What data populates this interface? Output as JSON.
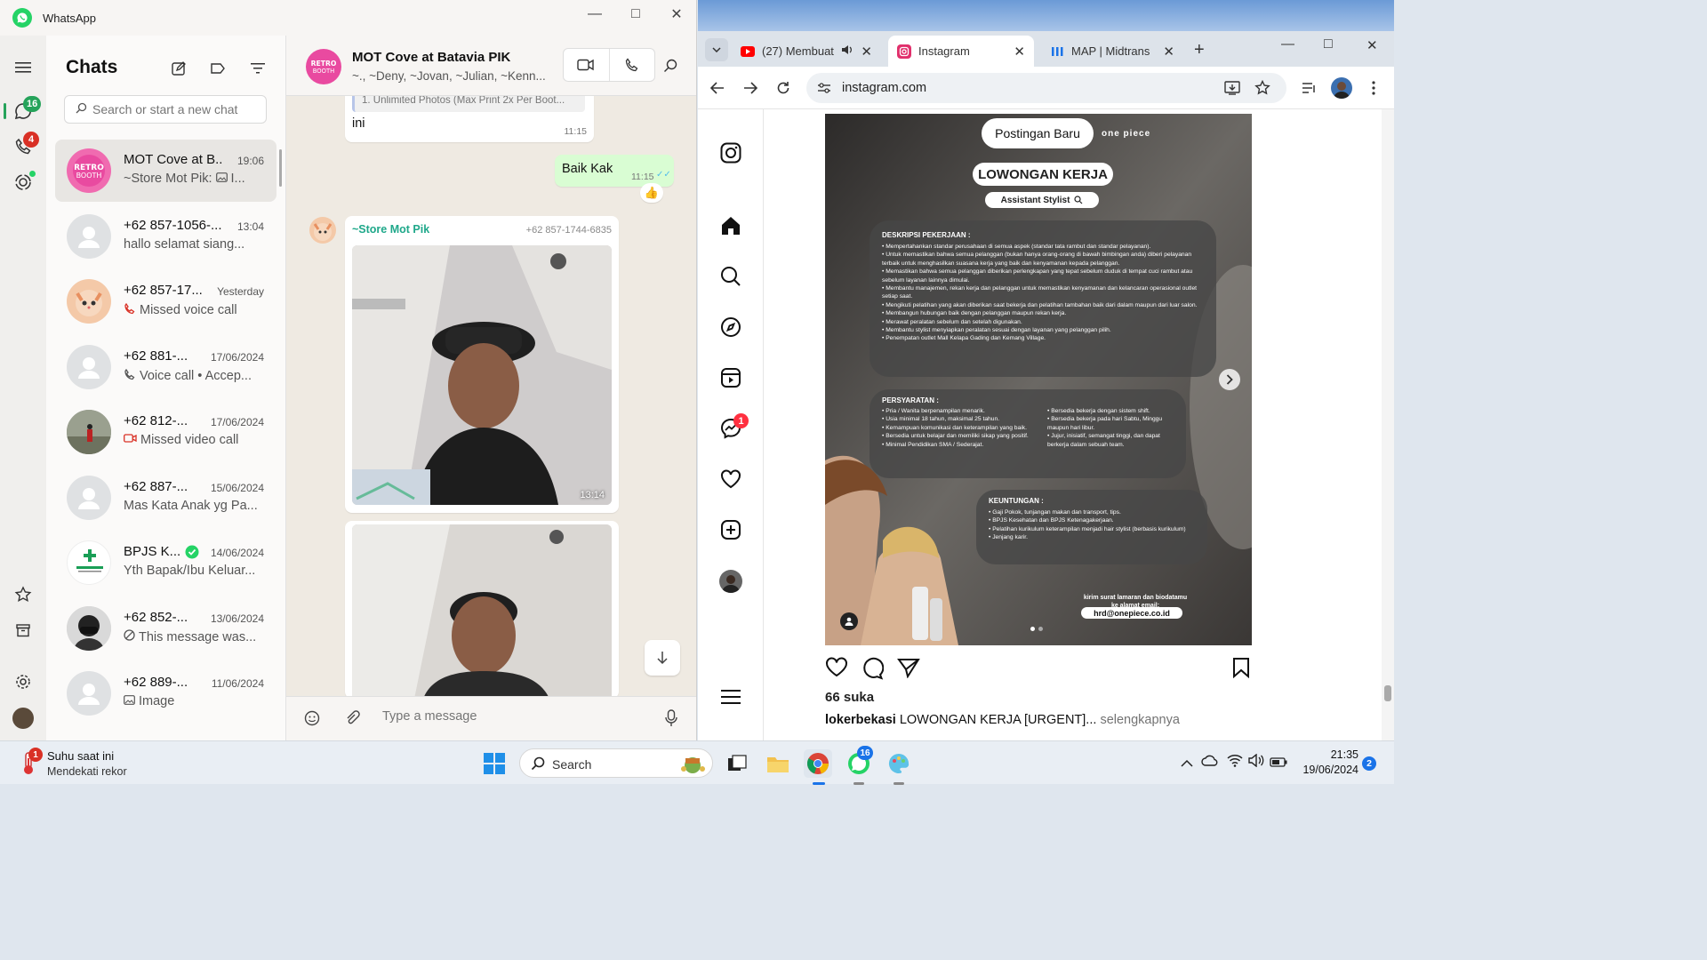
{
  "whatsapp": {
    "app_title": "WhatsApp",
    "rail": {
      "chats_badge": "16",
      "calls_badge": "4"
    },
    "list_title": "Chats",
    "search_placeholder": "Search or start a new chat",
    "chats": [
      {
        "name": "MOT Cove at B...",
        "time": "19:06",
        "preview": "~Store Mot Pik: ",
        "preview_suffix": "I...",
        "icon": "image-icon"
      },
      {
        "name": "+62 857-1056-...",
        "time": "13:04",
        "preview": "hallo selamat siang..."
      },
      {
        "name": "+62 857-17...",
        "time": "Yesterday",
        "preview": "Missed voice call",
        "icon": "missed-call-icon"
      },
      {
        "name": "+62 881-...",
        "time": "17/06/2024",
        "preview": "Voice call • Accep...",
        "icon": "incoming-call-icon"
      },
      {
        "name": "+62 812-...",
        "time": "17/06/2024",
        "preview": "Missed video call",
        "icon": "missed-video-icon"
      },
      {
        "name": "+62 887-...",
        "time": "15/06/2024",
        "preview": "Mas Kata Anak yg Pa..."
      },
      {
        "name": "BPJS K...",
        "time": "14/06/2024",
        "preview": "Yth Bapak/Ibu Keluar...",
        "icon": "verified-icon"
      },
      {
        "name": "+62 852-...",
        "time": "13/06/2024",
        "preview": "This message was...",
        "icon": "deleted-icon"
      },
      {
        "name": "+62 889-...",
        "time": "11/06/2024",
        "preview": "Image",
        "icon": "image-icon"
      }
    ],
    "conversation": {
      "title": "MOT Cove at Batavia PIK",
      "subtitle": "~., ~Deny, ~Jovan, ~Julian, ~Kenn...",
      "quoted_snippet": "1. Unlimited Photos (Max Print 2x Per Boot...",
      "msg1_text": "ini",
      "msg1_time": "11:15",
      "msg2_text": "Baik Kak",
      "msg2_time": "11:15",
      "reaction": "👍",
      "sender_name": "~Store Mot Pik",
      "sender_phone": "+62 857-1744-6835",
      "photo1_time": "13:14",
      "composer_placeholder": "Type a message"
    }
  },
  "chrome": {
    "tabs": [
      {
        "label": "(27) Membuat",
        "favicon_color": "#ff0000"
      },
      {
        "label": "Instagram",
        "favicon_color": "#e1306c"
      },
      {
        "label": "MAP | Midtrans",
        "favicon_color": "#1a73e8"
      }
    ],
    "url": "instagram.com",
    "instagram": {
      "messages_badge": "1",
      "post": {
        "header_pill": "Postingan Baru",
        "brand": "one piece",
        "headline": "LOWONGAN KERJA",
        "role": "Assistant Stylist",
        "desc_title": "DESKRIPSI PEKERJAAN :",
        "desc_items": [
          "Mempertahankan standar perusahaan di semua aspek (standar tata rambut dan standar pelayanan).",
          "Untuk memastikan bahwa semua pelanggan (bukan hanya orang-orang di bawah bimbingan anda) diberi pelayanan terbaik untuk menghasilkan suasana kerja yang baik dan kenyamanan kepada pelanggan.",
          "Memastikan bahwa semua pelanggan diberikan perlengkapan yang tepat sebelum duduk di tempat cuci rambut atau sebelum layanan lainnya dimulai.",
          "Membantu manajemen, rekan kerja dan pelanggan untuk memastikan kenyamanan dan kelancaran operasional outlet setiap saat.",
          "Mengikuti pelatihan yang akan diberikan saat bekerja dan pelatihan tambahan baik dari dalam maupun dari luar salon.",
          "Membangun hubungan baik dengan pelanggan maupun rekan kerja.",
          "Merawat peralatan sebelum dan setelah digunakan.",
          "Membantu stylist menyiapkan peralatan sesuai dengan layanan yang pelanggan pilih.",
          "Penempatan outlet Mall Kelapa Gading dan Kemang Village."
        ],
        "req_title": "PERSYARATAN :",
        "req_left": [
          "Pria / Wanita berpenampilan menarik.",
          "Usia minimal 18 tahun, maksimal 25 tahun.",
          "Kemampuan komunikasi dan keterampilan yang baik.",
          "Bersedia untuk belajar dan memiliki sikap yang positif.",
          "Minimal Pendidikan SMA / Sederajat."
        ],
        "req_right": [
          "Bersedia bekerja dengan sistem shift.",
          "Bersedia bekerja pada hari Sabtu, Minggu maupun hari libur.",
          "Jujur, inisiatif, semangat tinggi, dan dapat berkerja dalam sebuah team."
        ],
        "benefit_title": "KEUNTUNGAN :",
        "benefit_items": [
          "Gaji Pokok, tunjangan makan dan transport, tips.",
          "BPJS Kesehatan dan BPJS Ketenagakerjaan.",
          "Pelatihan kurikulum keterampilan menjadi hair stylist (berbasis kurikulum)",
          "Jenjang karir."
        ],
        "apply_note": "kirim surat lamaran dan biodatamu ke alamat email:",
        "email": "hrd@onepiece.co.id"
      },
      "likes": "66 suka",
      "caption_user": "lokerbekasi",
      "caption_text": " LOWONGAN KERJA [URGENT]... ",
      "caption_more": "selengkapnya"
    }
  },
  "taskbar": {
    "weather_title": "Suhu saat ini",
    "weather_sub": "Mendekati rekor",
    "weather_badge": "1",
    "search_label": "Search",
    "whatsapp_badge": "16",
    "time": "21:35",
    "date": "19/06/2024",
    "notif_count": "2"
  }
}
